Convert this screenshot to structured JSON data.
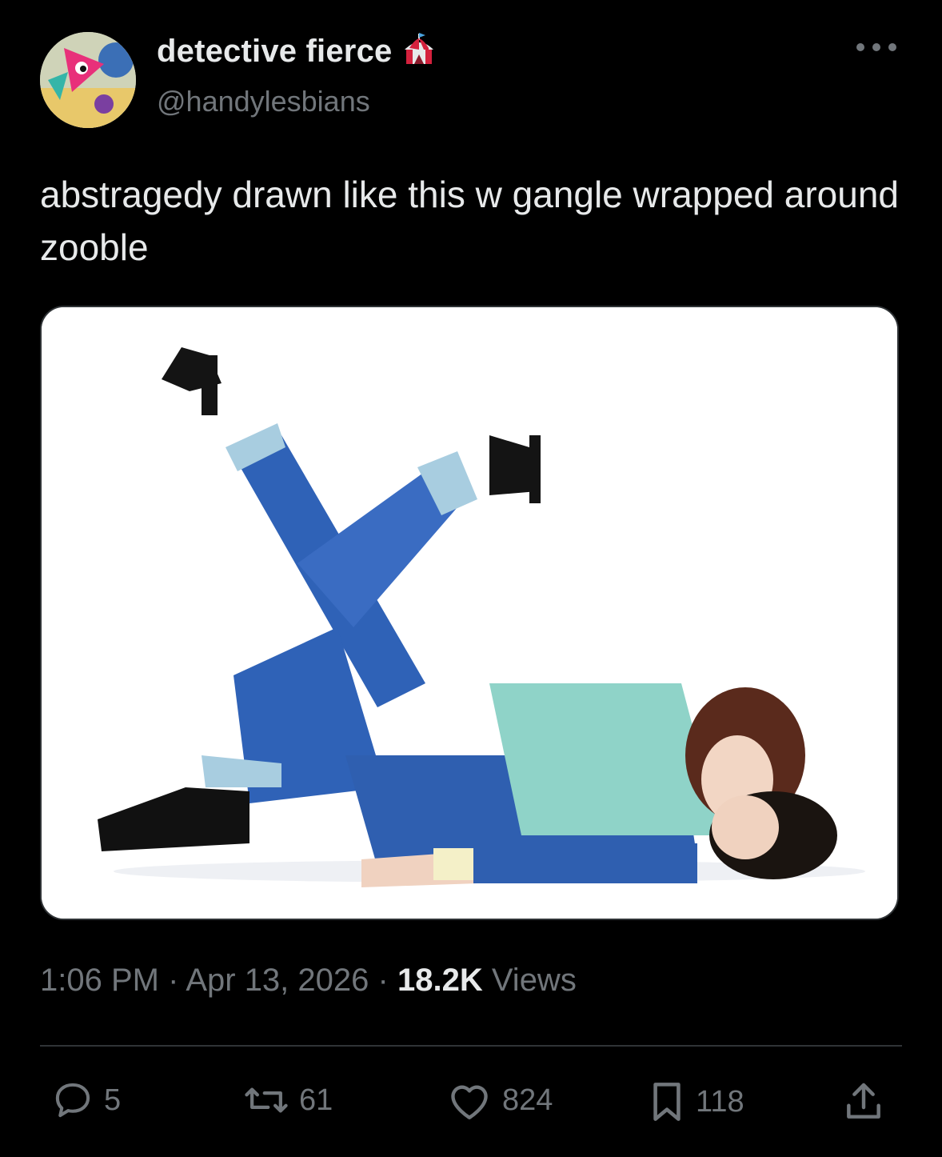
{
  "author": {
    "display_name": "detective fierce",
    "handle": "@handylesbians",
    "badge_icon": "circus-tent-icon"
  },
  "tweet": {
    "text": "abstragedy drawn like this w gangle wrapped around zooble",
    "time": "1:06 PM",
    "date": "Apr 13, 2026",
    "views_count": "18.2K",
    "views_label": "Views",
    "separator": "·"
  },
  "actions": {
    "replies": "5",
    "reposts": "61",
    "likes": "824",
    "bookmarks": "118"
  },
  "colors": {
    "background": "#000000",
    "text_primary": "#e7e9ea",
    "text_secondary": "#71767b",
    "divider": "#2f3336"
  }
}
